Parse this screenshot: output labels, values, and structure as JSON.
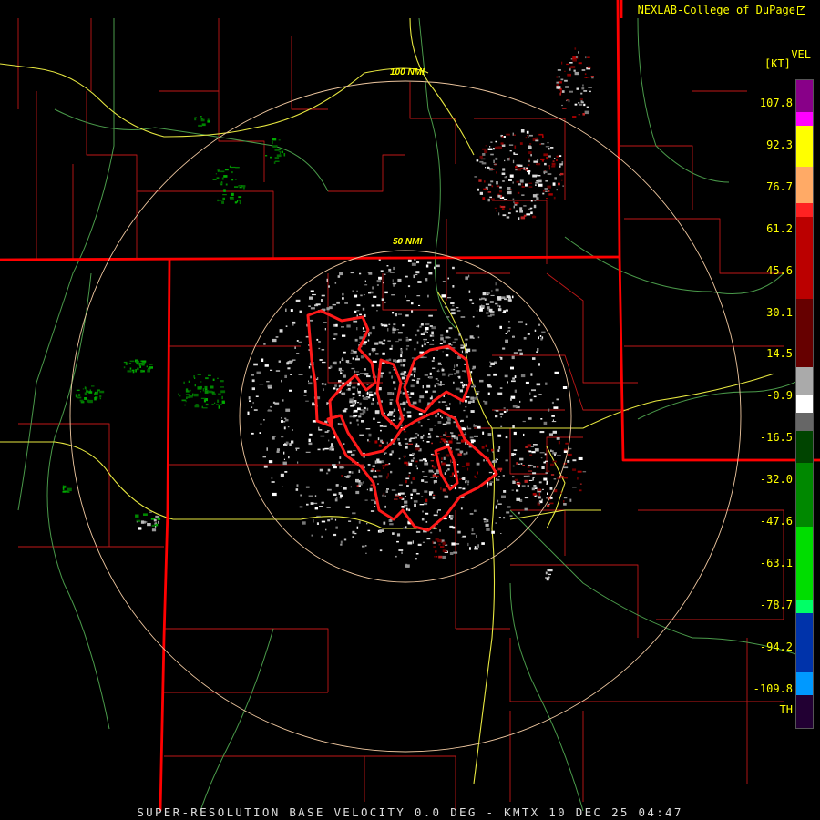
{
  "credit": {
    "label": "NEXLAB-College of DuPage",
    "icon": "external-link-icon"
  },
  "range_rings": [
    {
      "label": "50 NMI"
    },
    {
      "label": "100 NMI"
    }
  ],
  "legend": {
    "title": "VEL",
    "unit": "[KT]",
    "ticks": [
      "107.8",
      "92.3",
      "76.7",
      "61.2",
      "45.6",
      "30.1",
      "14.5",
      "-0.9",
      "-16.5",
      "-32.0",
      "-47.6",
      "-63.1",
      "-78.7",
      "-94.2",
      "-109.8",
      "TH"
    ],
    "colors": [
      "#880088",
      "#ff00ff",
      "#ffff00",
      "#ffaa66",
      "#ff2222",
      "#bb0000",
      "#660000",
      "#ffffff",
      "#006600",
      "#00bb00",
      "#00ff66",
      "#0033aa",
      "#0099ff",
      "#220033"
    ]
  },
  "colors": {
    "state_border": "#ff0000",
    "county_border": "#c01818",
    "highway": "#e8e840",
    "river": "#4a9a4a",
    "range_ring": "#f0c8a0",
    "warning_polygon": "#ff1a1a"
  },
  "footer": {
    "label": "SUPER-RESOLUTION BASE VELOCITY 0.0 DEG - KMTX 10 DEC 25 04:47"
  }
}
